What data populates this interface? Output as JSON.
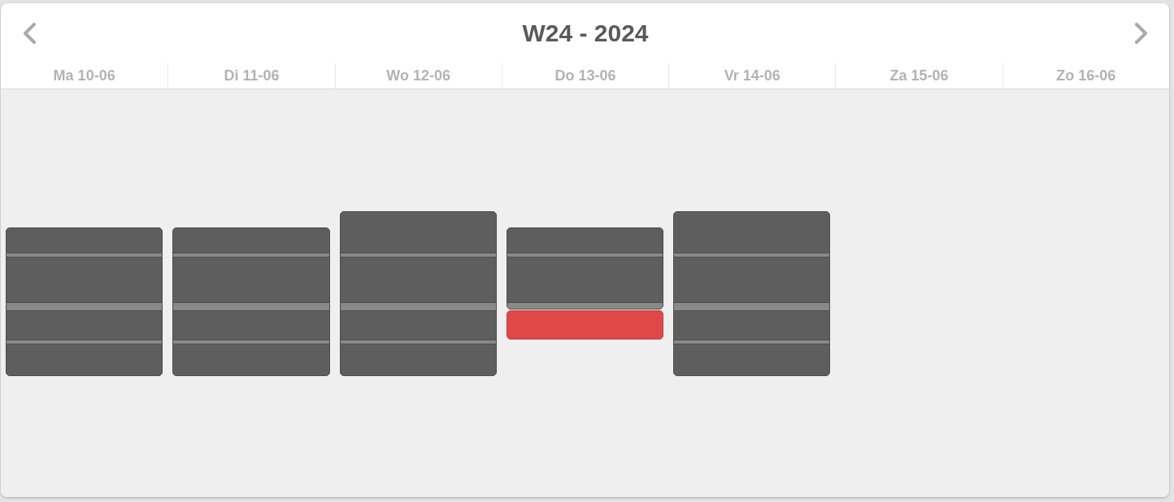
{
  "calendar": {
    "title": "W24 - 2024",
    "days": [
      {
        "label": "Ma 10-06",
        "blocks": [
          {
            "kind": "shift"
          }
        ]
      },
      {
        "label": "Di 11-06",
        "blocks": [
          {
            "kind": "shift"
          }
        ]
      },
      {
        "label": "Wo 12-06",
        "blocks": [
          {
            "kind": "shift"
          }
        ]
      },
      {
        "label": "Do 13-06",
        "blocks": [
          {
            "kind": "shift"
          },
          {
            "kind": "absence"
          }
        ]
      },
      {
        "label": "Vr 14-06",
        "blocks": [
          {
            "kind": "shift"
          }
        ]
      },
      {
        "label": "Za 15-06"
      },
      {
        "label": "Zo 16-06"
      }
    ]
  }
}
